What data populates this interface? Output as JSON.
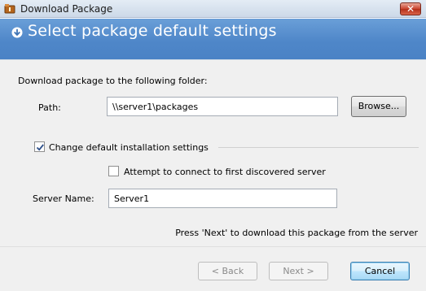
{
  "window": {
    "title": "Download Package",
    "close_glyph": "✕"
  },
  "header": {
    "title": "Select package default settings",
    "icon": "circle-arrow-down-icon"
  },
  "form": {
    "intro": "Download package to the following folder:",
    "path_label": "Path:",
    "path_value": "\\\\server1\\packages",
    "browse_label": "Browse...",
    "change_defaults_label": "Change default installation settings",
    "change_defaults_checked": true,
    "attempt_connect_label": "Attempt to connect to first discovered server",
    "attempt_connect_checked": false,
    "server_name_label": "Server Name:",
    "server_name_value": "Server1",
    "hint": "Press 'Next' to download this package from the server"
  },
  "footer": {
    "back_label": "< Back",
    "next_label": "Next >",
    "cancel_label": "Cancel"
  },
  "colors": {
    "header_bg": "#4f87c9",
    "dialog_bg": "#f0f0f0",
    "close_bg": "#c9432d"
  }
}
